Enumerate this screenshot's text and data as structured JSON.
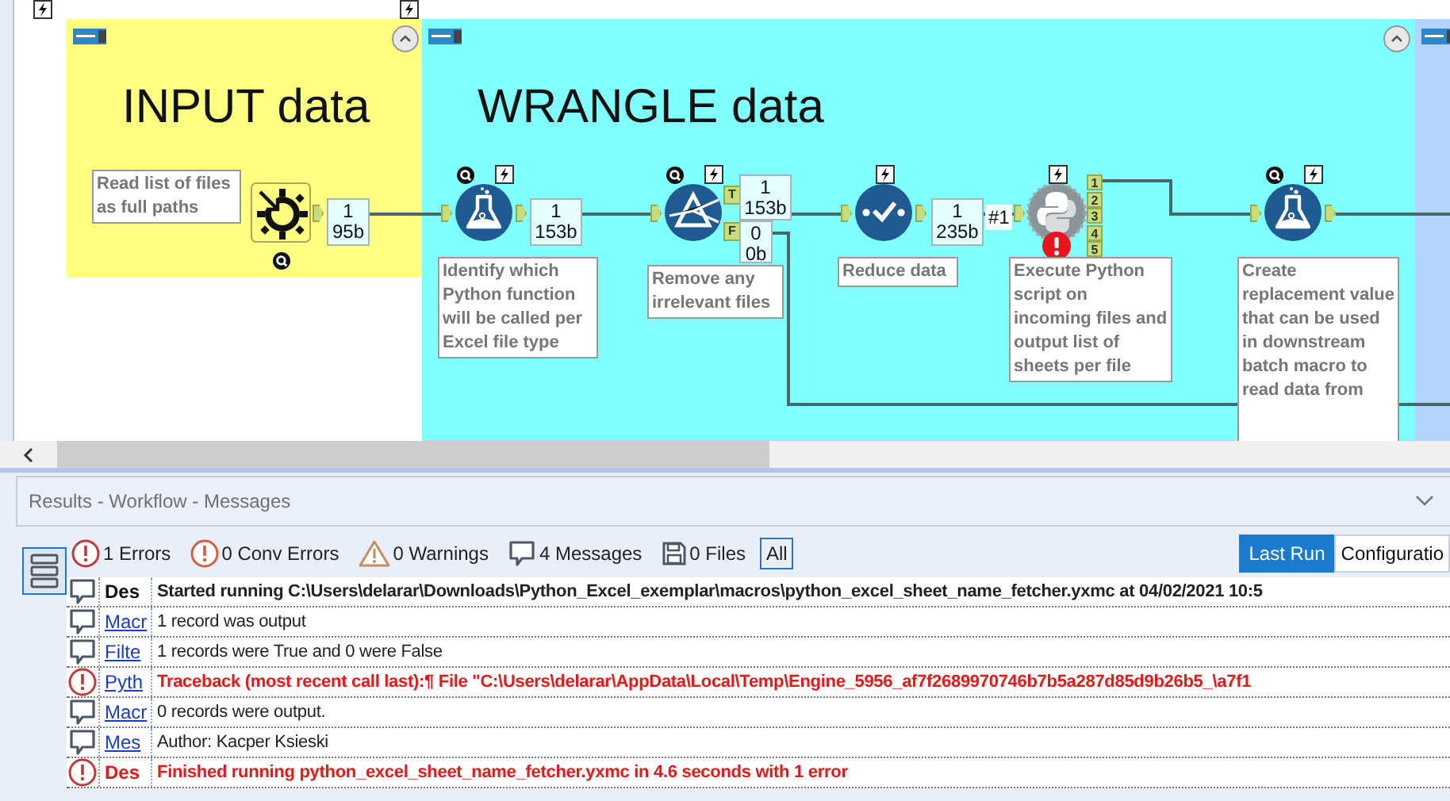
{
  "canvas": {
    "containers": [
      {
        "title": "INPUT data",
        "color": "#ffff80"
      },
      {
        "title": "WRANGLE data",
        "color": "#80ffff"
      },
      {
        "color": "#b4d4ff"
      }
    ],
    "tools": [
      {
        "kind": "input",
        "annotation": "Read list of files as full paths",
        "counts": [
          [
            "1",
            "95b"
          ]
        ],
        "error": false
      },
      {
        "kind": "formula",
        "annotation": "Identify which Python function will be called per Excel file type",
        "counts": [
          [
            "1",
            "153b"
          ]
        ],
        "error": false
      },
      {
        "kind": "filter",
        "annotation": "Remove any irrelevant files",
        "outputs": [
          "T",
          "F"
        ],
        "counts": [
          [
            "1",
            "153b"
          ],
          [
            "0",
            "0b"
          ]
        ],
        "error": false
      },
      {
        "kind": "sample",
        "annotation": "Reduce data",
        "counts": [
          [
            "1",
            "235b"
          ]
        ],
        "marker": "#1",
        "error": false
      },
      {
        "kind": "python",
        "annotation": "Execute Python script on incoming files and output list of sheets per file",
        "outputs": [
          "1",
          "2",
          "3",
          "4",
          "5"
        ],
        "error": true
      },
      {
        "kind": "formula",
        "annotation": "Create replacement value that can be used in downstream batch macro to read data from",
        "error": false
      }
    ]
  },
  "results": {
    "title": "Results - Workflow - Messages",
    "filters": [
      {
        "kind": "error",
        "label": "1 Errors",
        "selected": false
      },
      {
        "kind": "conv-error",
        "label": "0 Conv Errors",
        "selected": false
      },
      {
        "kind": "warning",
        "label": "0 Warnings",
        "selected": false
      },
      {
        "kind": "message",
        "label": "4 Messages",
        "selected": false
      },
      {
        "kind": "file",
        "label": "0 Files",
        "selected": false
      },
      {
        "kind": "all",
        "label": "All",
        "selected": true
      }
    ],
    "tabs": [
      {
        "label": "Last Run",
        "selected": true
      },
      {
        "label": "Configuratio",
        "selected": false
      }
    ],
    "rows": [
      {
        "kind": "message",
        "tool": "Des",
        "link": false,
        "emphasis": true,
        "text": "Started running C:\\Users\\delarar\\Downloads\\Python_Excel_exemplar\\macros\\python_excel_sheet_name_fetcher.yxmc at 04/02/2021 10:5"
      },
      {
        "kind": "message",
        "tool": "Macr",
        "link": true,
        "emphasis": false,
        "text": "1 record was output"
      },
      {
        "kind": "message",
        "tool": "Filte",
        "link": true,
        "emphasis": false,
        "text": "1 records were True and 0 were False"
      },
      {
        "kind": "error",
        "tool": "Pyth",
        "link": true,
        "emphasis": true,
        "text": "Traceback (most recent call last):¶  File \"C:\\Users\\delarar\\AppData\\Local\\Temp\\Engine_5956_af7f2689970746b7b5a287d85d9b26b5_\\a7f1"
      },
      {
        "kind": "message",
        "tool": "Macr",
        "link": true,
        "emphasis": false,
        "text": "0 records were output."
      },
      {
        "kind": "message",
        "tool": "Mes",
        "link": true,
        "emphasis": false,
        "text": "Author: Kacper Ksieski"
      },
      {
        "kind": "error",
        "tool": "Des",
        "link": false,
        "emphasis": true,
        "text": "Finished running python_excel_sheet_name_fetcher.yxmc in 4.6 seconds with 1 error"
      }
    ]
  }
}
